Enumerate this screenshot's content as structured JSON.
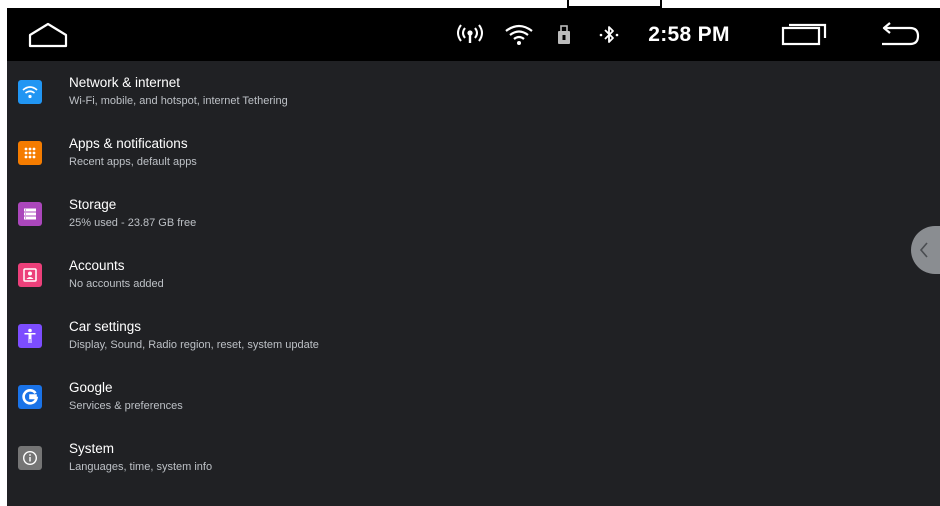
{
  "status_bar": {
    "time": "2:58 PM",
    "icons": [
      "home-icon",
      "signal-broadcast-icon",
      "wifi-icon",
      "usb-lock-icon",
      "bluetooth-icon",
      "recents-icon",
      "back-icon"
    ]
  },
  "settings": {
    "items": [
      {
        "title": "Network & internet",
        "subtitle": "Wi-Fi, mobile, and hotspot, internet Tethering",
        "icon": "wifi-icon",
        "color": "#2196f3"
      },
      {
        "title": "Apps & notifications",
        "subtitle": "Recent apps, default apps",
        "icon": "apps-grid-icon",
        "color": "#f57c00"
      },
      {
        "title": "Storage",
        "subtitle": "25% used - 23.87 GB free",
        "icon": "storage-icon",
        "color": "#ab47bc"
      },
      {
        "title": "Accounts",
        "subtitle": "No accounts added",
        "icon": "account-icon",
        "color": "#ec407a"
      },
      {
        "title": "Car settings",
        "subtitle": "Display, Sound, Radio region, reset, system update",
        "icon": "accessibility-icon",
        "color": "#7c4dff"
      },
      {
        "title": "Google",
        "subtitle": "Services & preferences",
        "icon": "google-icon",
        "color": "#1a73e8"
      },
      {
        "title": "System",
        "subtitle": "Languages, time, system info",
        "icon": "info-icon",
        "color": "#757575"
      }
    ]
  },
  "colors": {
    "background": "#202124",
    "status_bar": "#000000",
    "title_text": "#ffffff",
    "subtitle_text": "#bdc1c6"
  }
}
